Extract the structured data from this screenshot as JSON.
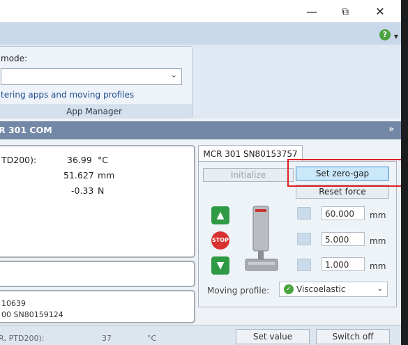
{
  "window": {
    "controls": {
      "minimize": "—",
      "restore": "⧉",
      "close": "✕"
    }
  },
  "ribbon": {
    "help_icon": "?",
    "mode_group": {
      "label": "mode:",
      "select_value": "",
      "link_text": "tering apps and moving profiles",
      "group_title": "App Manager"
    }
  },
  "section": {
    "title": "R 301 COM",
    "expand": "»"
  },
  "measurements": [
    {
      "label": "TD200):",
      "value": "36.99",
      "unit": "°C"
    },
    {
      "label": "",
      "value": "51.627",
      "unit": "mm"
    },
    {
      "label": "",
      "value": "-0.33",
      "unit": "N"
    }
  ],
  "device_info": {
    "line1": "10639",
    "line2": "00 SN80159124"
  },
  "device_tab": {
    "title": "MCR 301 SN80153757",
    "buttons": {
      "initialize": "Initialize",
      "set_zero_gap": "Set zero-gap",
      "reset_force": "Reset force"
    },
    "nav": {
      "up": "up-arrow",
      "stop": "STOP",
      "down": "down-arrow"
    },
    "positions": [
      {
        "value": "60.000",
        "unit": "mm"
      },
      {
        "value": "5.000",
        "unit": "mm"
      },
      {
        "value": "1.000",
        "unit": "mm"
      }
    ],
    "moving_profile": {
      "label": "Moving profile:",
      "value": "Viscoelastic"
    }
  },
  "status_bar": {
    "left_text": "R, PTD200):",
    "value": "37",
    "unit": "°C",
    "set_value_label": "Set value",
    "switch_off_label": "Switch off"
  },
  "colors": {
    "accent_blue": "#3f8dc6",
    "section_header": "#7388a6",
    "highlight": "#e02020"
  }
}
